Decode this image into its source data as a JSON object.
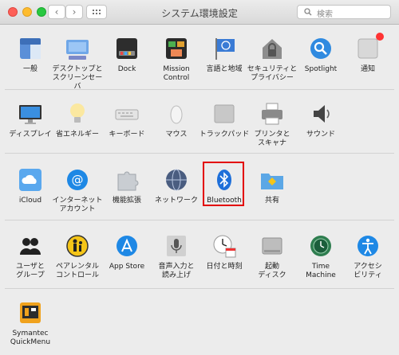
{
  "window": {
    "title": "システム環境設定"
  },
  "search": {
    "placeholder": "検索"
  },
  "rows": [
    [
      {
        "label": "一般",
        "icon": "general-icon",
        "name": "general"
      },
      {
        "label": "デスクトップと\nスクリーンセーバ",
        "icon": "desktop-icon",
        "name": "desktop-screensaver"
      },
      {
        "label": "Dock",
        "icon": "dock-icon",
        "name": "dock"
      },
      {
        "label": "Mission\nControl",
        "icon": "mission-control-icon",
        "name": "mission-control"
      },
      {
        "label": "言語と地域",
        "icon": "language-region-icon",
        "name": "language-region"
      },
      {
        "label": "セキュリティと\nプライバシー",
        "icon": "security-icon",
        "name": "security-privacy"
      },
      {
        "label": "Spotlight",
        "icon": "spotlight-icon",
        "name": "spotlight"
      },
      {
        "label": "通知",
        "icon": "notifications-icon",
        "name": "notifications"
      }
    ],
    [
      {
        "label": "ディスプレイ",
        "icon": "display-icon",
        "name": "displays"
      },
      {
        "label": "省エネルギー",
        "icon": "energy-saver-icon",
        "name": "energy-saver"
      },
      {
        "label": "キーボード",
        "icon": "keyboard-icon",
        "name": "keyboard"
      },
      {
        "label": "マウス",
        "icon": "mouse-icon",
        "name": "mouse"
      },
      {
        "label": "トラックパッド",
        "icon": "trackpad-icon",
        "name": "trackpad"
      },
      {
        "label": "プリンタと\nスキャナ",
        "icon": "printer-icon",
        "name": "printers-scanners"
      },
      {
        "label": "サウンド",
        "icon": "sound-icon",
        "name": "sound"
      }
    ],
    [
      {
        "label": "iCloud",
        "icon": "icloud-icon",
        "name": "icloud"
      },
      {
        "label": "インターネット\nアカウント",
        "icon": "internet-accounts-icon",
        "name": "internet-accounts"
      },
      {
        "label": "機能拡張",
        "icon": "extensions-icon",
        "name": "extensions"
      },
      {
        "label": "ネットワーク",
        "icon": "network-icon",
        "name": "network"
      },
      {
        "label": "Bluetooth",
        "icon": "bluetooth-icon",
        "name": "bluetooth"
      },
      {
        "label": "共有",
        "icon": "sharing-icon",
        "name": "sharing"
      }
    ],
    [
      {
        "label": "ユーザと\nグループ",
        "icon": "users-groups-icon",
        "name": "users-groups"
      },
      {
        "label": "ペアレンタル\nコントロール",
        "icon": "parental-controls-icon",
        "name": "parental-controls"
      },
      {
        "label": "App Store",
        "icon": "app-store-icon",
        "name": "app-store"
      },
      {
        "label": "音声入力と\n読み上げ",
        "icon": "dictation-speech-icon",
        "name": "dictation-speech"
      },
      {
        "label": "日付と時刻",
        "icon": "date-time-icon",
        "name": "date-time"
      },
      {
        "label": "起動\nディスク",
        "icon": "startup-disk-icon",
        "name": "startup-disk"
      },
      {
        "label": "Time\nMachine",
        "icon": "time-machine-icon",
        "name": "time-machine"
      },
      {
        "label": "アクセシ\nビリティ",
        "icon": "accessibility-icon",
        "name": "accessibility"
      }
    ],
    [
      {
        "label": "Symantec\nQuickMenu",
        "icon": "symantec-icon",
        "name": "symantec-quickmenu"
      }
    ]
  ],
  "notifications_badge_color": "#ff3b30",
  "highlight_color": "#e30000"
}
